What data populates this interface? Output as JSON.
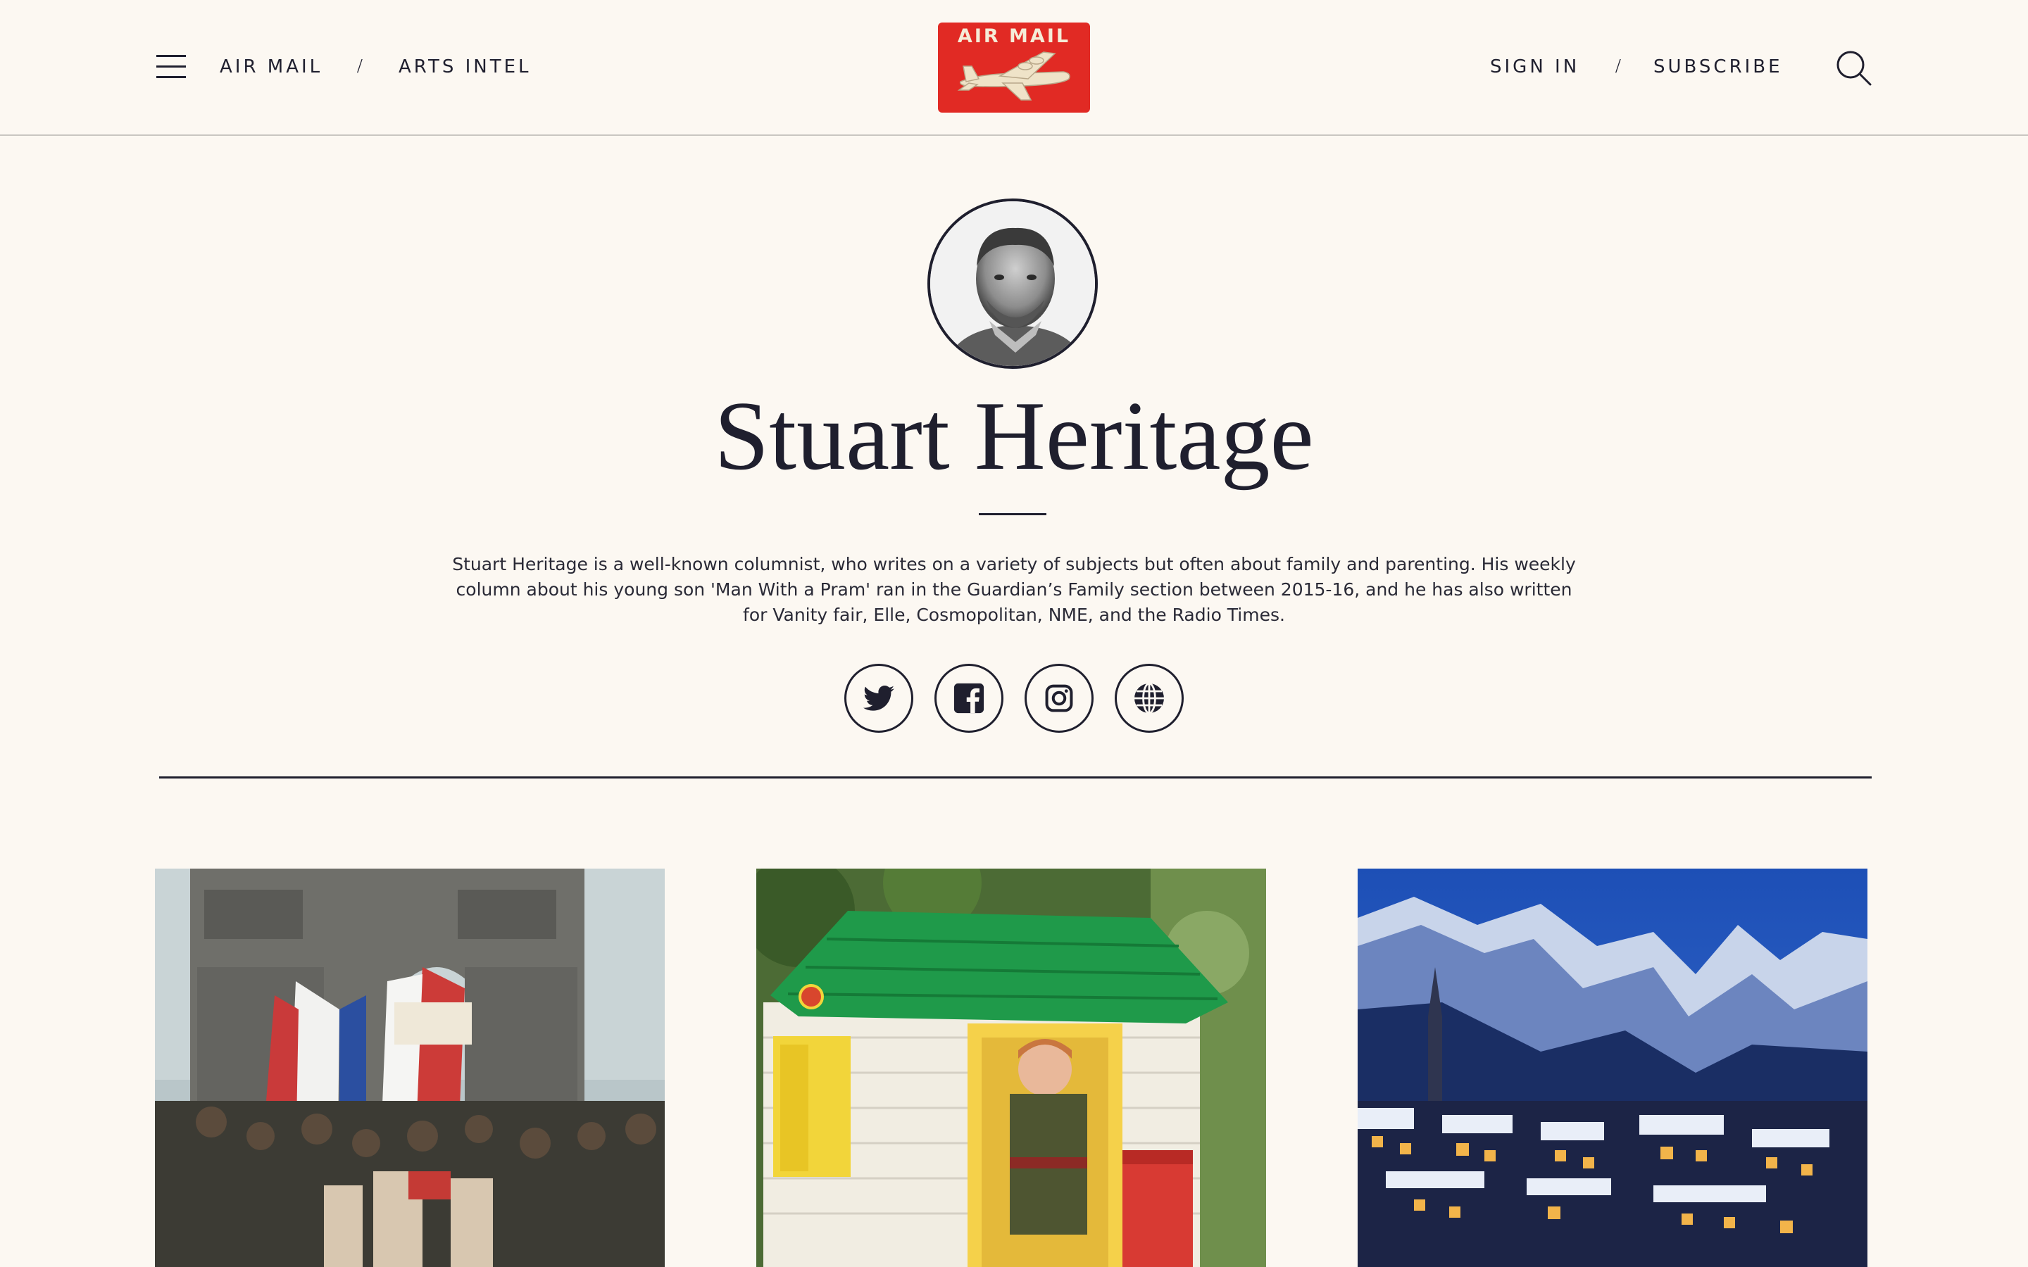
{
  "header": {
    "nav_left": [
      "AIR MAIL",
      "ARTS INTEL"
    ],
    "separator": "/",
    "logo_text": "AIR MAIL",
    "nav_right": [
      "SIGN IN",
      "SUBSCRIBE"
    ],
    "menu_icon": "hamburger-menu-icon",
    "search_icon": "search-icon"
  },
  "author": {
    "name": "Stuart Heritage",
    "bio": "Stuart Heritage is a well-known columnist, who writes on a variety of subjects but often about family and parenting. His weekly column about his young son 'Man With a Pram' ran in the Guardian’s Family section between 2015-16, and he has also written for Vanity fair, Elle, Cosmopolitan, NME, and the Radio Times."
  },
  "social": [
    {
      "name": "twitter",
      "icon": "twitter-icon"
    },
    {
      "name": "facebook",
      "icon": "facebook-icon"
    },
    {
      "name": "instagram",
      "icon": "instagram-icon"
    },
    {
      "name": "website",
      "icon": "globe-icon"
    }
  ],
  "articles": [
    {
      "image": "Parade beneath the Arc de Triomphe with French flags"
    },
    {
      "image": "Young boy standing in a toy playhouse with green roof"
    },
    {
      "image": "Snowy mountain town at dusk"
    }
  ],
  "colors": {
    "background": "#fcf8f2",
    "text": "#1f1f2e",
    "logo_red": "#e12a24"
  }
}
